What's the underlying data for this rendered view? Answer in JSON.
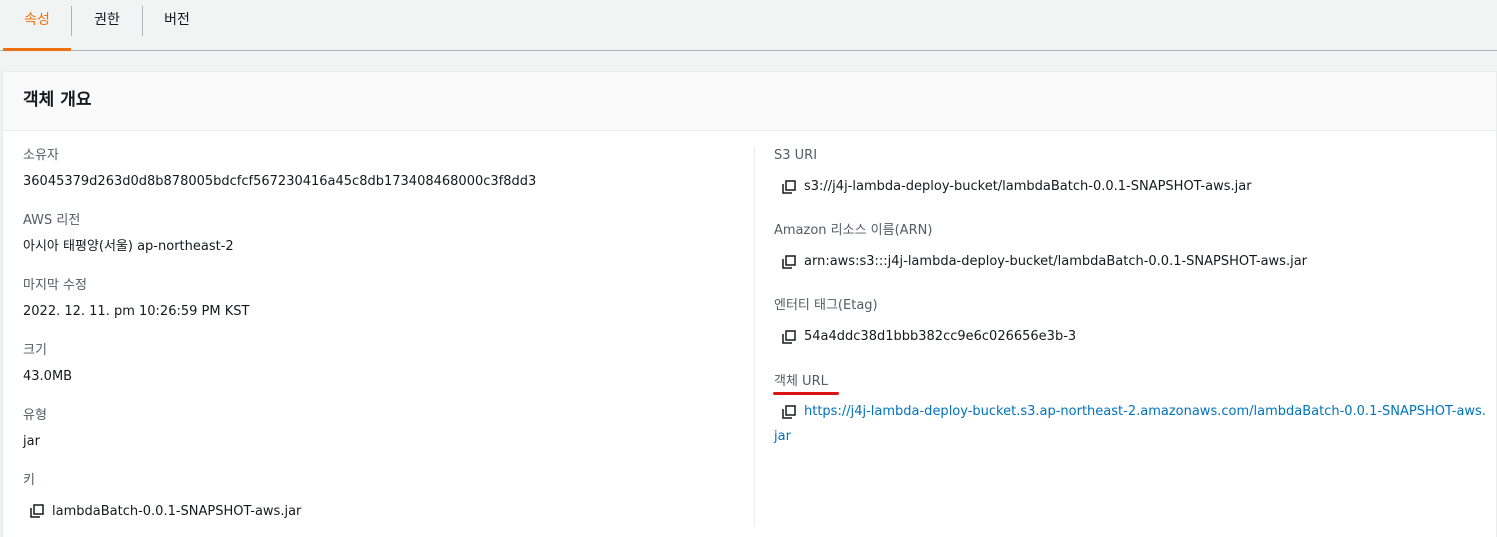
{
  "tabs": [
    {
      "label": "속성",
      "active": true
    },
    {
      "label": "권한",
      "active": false
    },
    {
      "label": "버전",
      "active": false
    }
  ],
  "overview": {
    "title": "객체 개요",
    "left": {
      "owner": {
        "label": "소유자",
        "value": "36045379d263d0d8b878005bdcfcf567230416a45c8db173408468000c3f8dd3"
      },
      "region": {
        "label": "AWS 리전",
        "value": "아시아 태평양(서울) ap-northeast-2"
      },
      "last_modified": {
        "label": "마지막 수정",
        "value": "2022. 12. 11. pm 10:26:59 PM KST"
      },
      "size": {
        "label": "크기",
        "value": "43.0MB"
      },
      "type": {
        "label": "유형",
        "value": "jar"
      },
      "key": {
        "label": "키",
        "value": "lambdaBatch-0.0.1-SNAPSHOT-aws.jar"
      }
    },
    "right": {
      "s3_uri": {
        "label": "S3 URI",
        "value": "s3://j4j-lambda-deploy-bucket/lambdaBatch-0.0.1-SNAPSHOT-aws.jar"
      },
      "arn": {
        "label": "Amazon 리소스 이름(ARN)",
        "value": "arn:aws:s3:::j4j-lambda-deploy-bucket/lambdaBatch-0.0.1-SNAPSHOT-aws.jar"
      },
      "etag": {
        "label": "엔터티 태그(Etag)",
        "value": "54a4ddc38d1bbb382cc9e6c026656e3b-3"
      },
      "object_url": {
        "label": "객체 URL",
        "value_line1": "https://j4j-lambda-deploy-bucket.s3.ap-northeast-2.amazonaws.com/lambdaBatch-0.0.1-SNAPSHOT-aws.",
        "value_line2": "jar"
      }
    }
  },
  "icons": {
    "copy": "copy-icon"
  },
  "colors": {
    "accent": "#ec7211",
    "link": "#0073bb",
    "highlight": "#d91515"
  }
}
